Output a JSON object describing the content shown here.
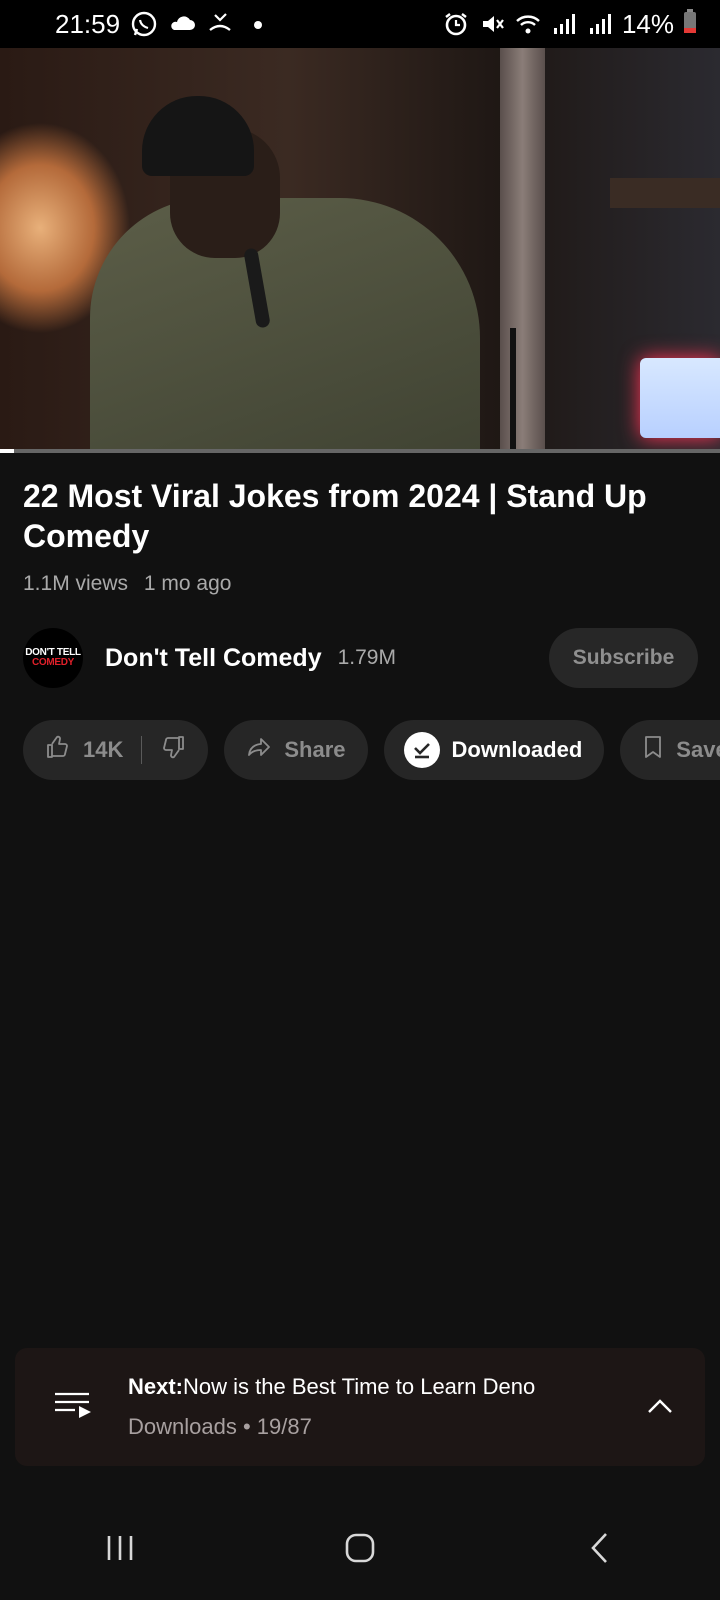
{
  "status_bar": {
    "time": "21:59",
    "battery": "14%",
    "icons_left": [
      "whatsapp-icon",
      "cloud-icon",
      "missed-call-icon",
      "dot-icon"
    ],
    "icons_right": [
      "alarm-icon",
      "mute-icon",
      "wifi-icon",
      "signal-icon",
      "signal-icon",
      "battery-icon"
    ]
  },
  "video": {
    "progress_fraction": 0.02,
    "colors": {
      "progress": "#ffffff",
      "track": "#666666"
    }
  },
  "title": "22 Most Viral Jokes from 2024 | Stand Up Comedy",
  "meta": {
    "views": "1.1M views",
    "age": "1 mo ago"
  },
  "channel": {
    "avatar_line1": "DON'T TELL",
    "avatar_line2": "COMEDY",
    "name": "Don't Tell Comedy",
    "subscribers": "1.79M",
    "subscribe_label": "Subscribe"
  },
  "actions": {
    "likes": "14K",
    "share": "Share",
    "downloaded": "Downloaded",
    "save": "Save"
  },
  "next_bar": {
    "prefix": "Next:",
    "title": "Now is the Best Time to Learn Deno",
    "playlist": "Downloads",
    "position": "19/87"
  },
  "nav": [
    "recents-icon",
    "home-icon",
    "back-icon"
  ],
  "colors": {
    "background": "#111111",
    "accent_red": "#e0202a"
  }
}
